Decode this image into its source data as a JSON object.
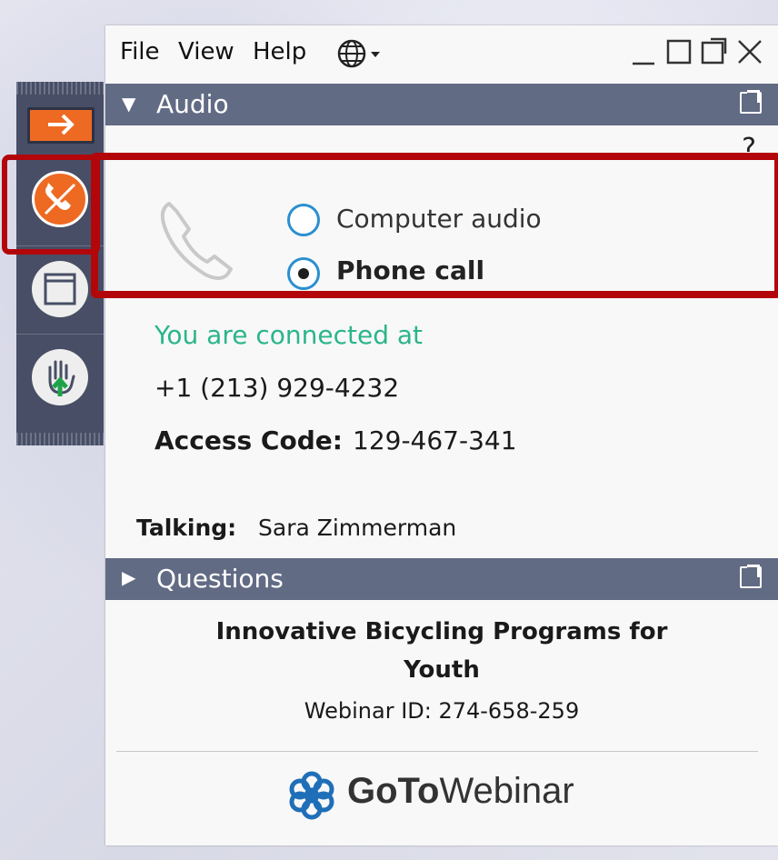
{
  "menu": {
    "file": "File",
    "view": "View",
    "help": "Help"
  },
  "audio_panel": {
    "title": "Audio",
    "help_glyph": "?",
    "options": [
      {
        "label": "Computer audio",
        "selected": false
      },
      {
        "label": "Phone call",
        "selected": true
      }
    ],
    "connected_text": "You are connected at",
    "phone_number": "+1 (213) 929-4232",
    "access_code_label": "Access Code:",
    "access_code": "129-467-341",
    "talking_label": "Talking:",
    "talking_name": "Sara Zimmerman"
  },
  "questions_panel": {
    "title": "Questions"
  },
  "webinar": {
    "title_line1": "Innovative Bicycling Programs for",
    "title_line2": "Youth",
    "webinar_id": "Webinar ID: 274-658-259"
  },
  "brand": {
    "bold": "GoTo",
    "light": "Webinar"
  },
  "icons": {
    "language": "globe-icon",
    "grab_tab": "arrow-right-icon",
    "audio": "phone-icon",
    "screen": "window-icon",
    "hand": "raise-hand-icon"
  },
  "colors": {
    "header": "#626b84",
    "toolbar": "#474e65",
    "accent_orange": "#ee6a22",
    "highlight_red": "#b3060a",
    "connected_green": "#2bb58a",
    "radio_blue": "#2b8fcf"
  }
}
